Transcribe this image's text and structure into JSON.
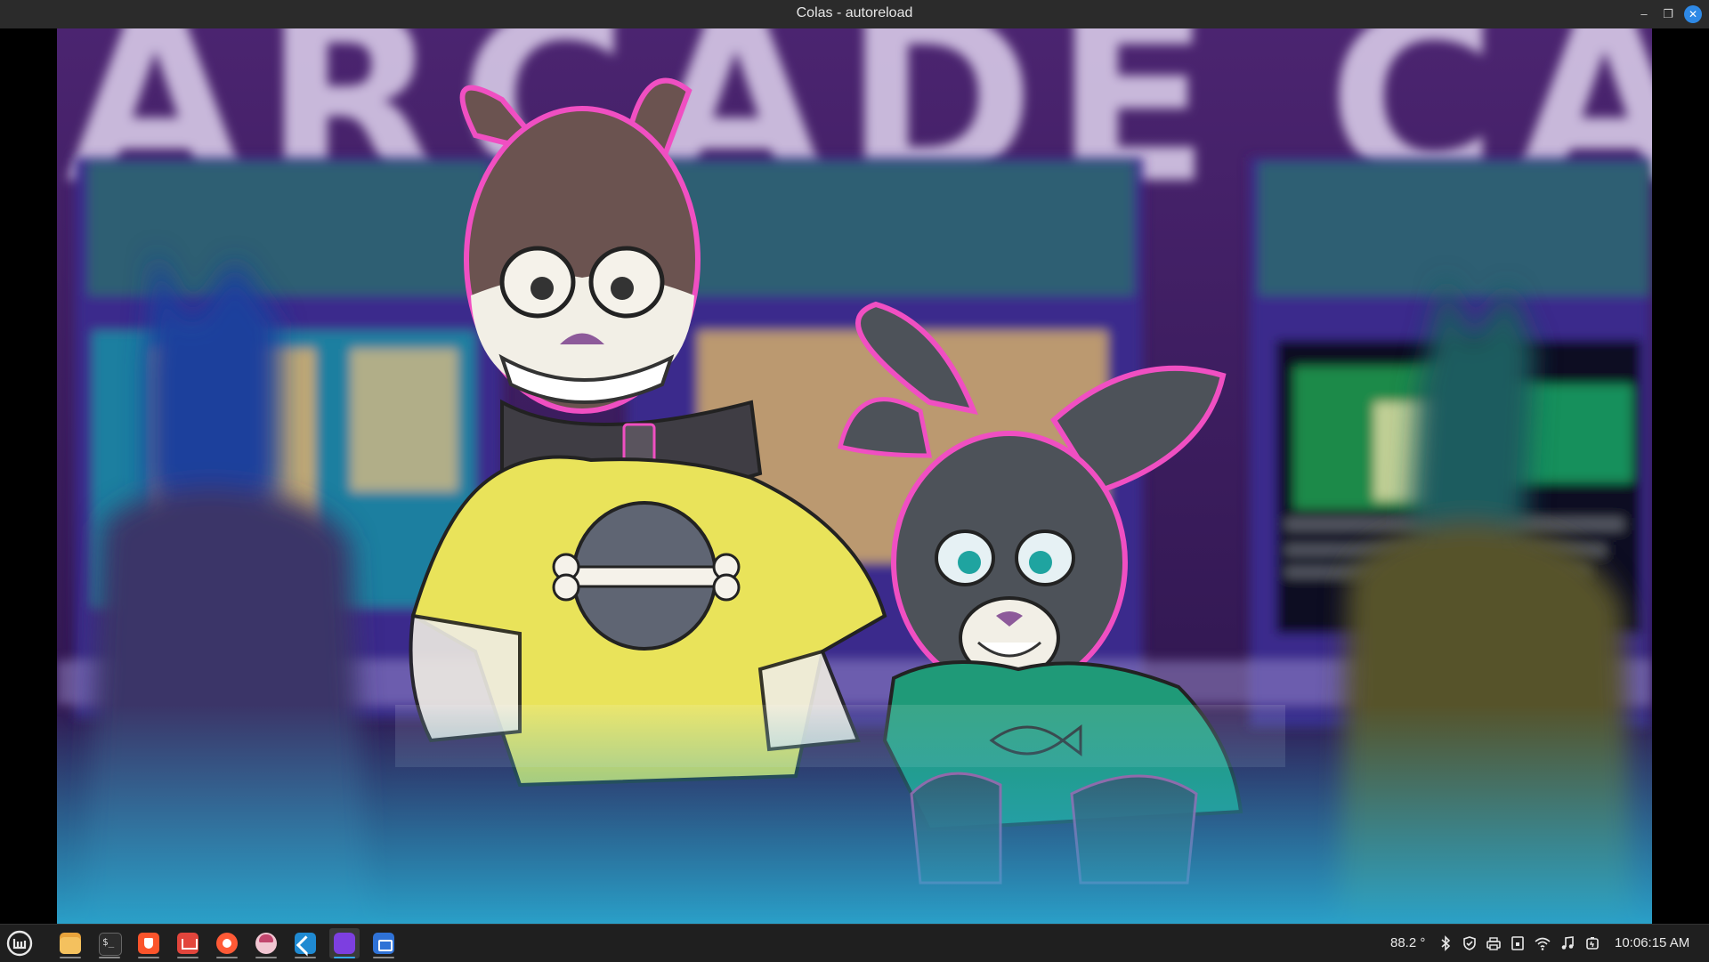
{
  "window": {
    "title": "Colas - autoreload",
    "controls": {
      "minimize": "–",
      "maximize": "❐",
      "close": "✕"
    }
  },
  "scene": {
    "background_sign_text": "ARCADE CAL",
    "colors": {
      "backdrop": "#3d1e5e",
      "neon": "#f3e9ff",
      "yellow_shirt": "#e9e35a",
      "green_shirt": "#1f9a78",
      "floor_glow": "#29a3c9",
      "pink_rim": "#f04fc2"
    }
  },
  "taskbar": {
    "menu_icon": "linux-mint-menu-icon",
    "apps": [
      {
        "name": "files-app-icon",
        "active": false
      },
      {
        "name": "terminal-app-icon",
        "active": false
      },
      {
        "name": "brave-browser-app-icon",
        "active": false
      },
      {
        "name": "git-client-app-icon",
        "active": false
      },
      {
        "name": "firefox-dev-app-icon",
        "active": false
      },
      {
        "name": "character-app-icon",
        "active": false
      },
      {
        "name": "vscode-app-icon",
        "active": false
      },
      {
        "name": "colas-app-icon",
        "active": true
      },
      {
        "name": "screenshot-app-icon",
        "active": false
      }
    ],
    "temperature": "88.2 °",
    "clock": "10:06:15 AM",
    "tray_icons": [
      "bluetooth-icon",
      "shield-icon",
      "printer-icon",
      "removable-drive-icon",
      "wifi-icon",
      "music-icon",
      "battery-icon"
    ]
  }
}
